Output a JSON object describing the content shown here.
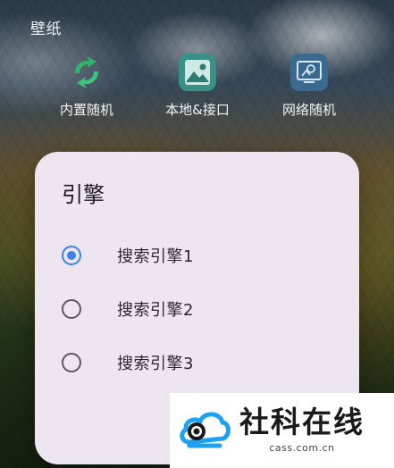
{
  "section": {
    "title": "壁纸"
  },
  "shortcuts": [
    {
      "label": "内置随机",
      "icon": "sync-arrows-icon"
    },
    {
      "label": "本地&接口",
      "icon": "image-icon"
    },
    {
      "label": "网络随机",
      "icon": "web-image-icon"
    }
  ],
  "dialog": {
    "title": "引擎",
    "options": [
      {
        "label": "搜索引擎1",
        "selected": true
      },
      {
        "label": "搜索引擎2",
        "selected": false
      },
      {
        "label": "搜索引擎3",
        "selected": false
      }
    ]
  },
  "watermark": {
    "name": "社科在线",
    "domain": "cass.com.cn"
  },
  "colors": {
    "accent": "#3e82e8",
    "dialog_bg": "#ede6f1",
    "watermark_blue": "#1da1f2"
  }
}
